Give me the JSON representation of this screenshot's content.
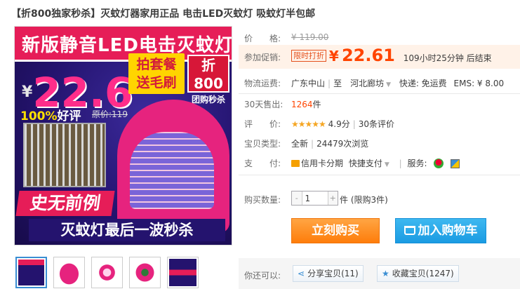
{
  "title": "【折800独家秒杀】灭蚊灯器家用正品 电击LED灭蚊灯 吸蚊灯半包邮",
  "main_image": {
    "banner": "新版静音LED电击灭蚊灯",
    "price_yen": "¥",
    "price_num": "22.6",
    "badge1_line1": "拍套餐",
    "badge1_line2": "送毛刷",
    "badge2_line1": "折800",
    "badge2_line2": "团购秒杀",
    "good_pct": "100%",
    "good_text": "好评",
    "orig_label": "原价:119",
    "slogan1": "史无前例",
    "slogan2": "灭蚊灯最后一波秒杀"
  },
  "thumbnails": [
    "thumb-1",
    "thumb-2",
    "thumb-3",
    "thumb-4",
    "thumb-5"
  ],
  "info": {
    "price_label": "价　　格:",
    "price_value": "¥ 119.00",
    "promo_label": "参加促销:",
    "promo_tag": "限时打折",
    "promo_yen": "¥",
    "promo_value": "22.61",
    "countdown": "109小时25分钟 后结束",
    "shipping_label": "物流运费:",
    "shipping_from": "广东中山",
    "shipping_to": "至　河北廊坊",
    "shipping_express": "快递: 免运费",
    "shipping_ems": "EMS: ¥ 8.00",
    "sold_label": "30天售出:",
    "sold_value": "1264",
    "sold_unit": "件",
    "rating_label": "评　　价:",
    "rating_stars": "★★★★★",
    "rating_score": "4.9分",
    "rating_count": "30条评价",
    "type_label": "宝贝类型:",
    "type_value": "全新",
    "views": "24479次浏览",
    "pay_label": "支　　付:",
    "pay_credit": "信用卡分期",
    "pay_quick": "快捷支付",
    "service_label": "服务:",
    "qty_label": "购买数量:",
    "qty_minus": "-",
    "qty_value": "1",
    "qty_plus": "+",
    "qty_unit": "件 (限购3件)",
    "buy_button": "立刻购买",
    "cart_button": "加入购物车",
    "share_label": "你还可以:",
    "share_button": "分享宝贝(11)",
    "collect_button": "收藏宝贝(1247)"
  },
  "colors": {
    "accent_orange": "#ff8a2a",
    "price_red": "#ff4400",
    "cart_blue": "#1a9be2"
  }
}
